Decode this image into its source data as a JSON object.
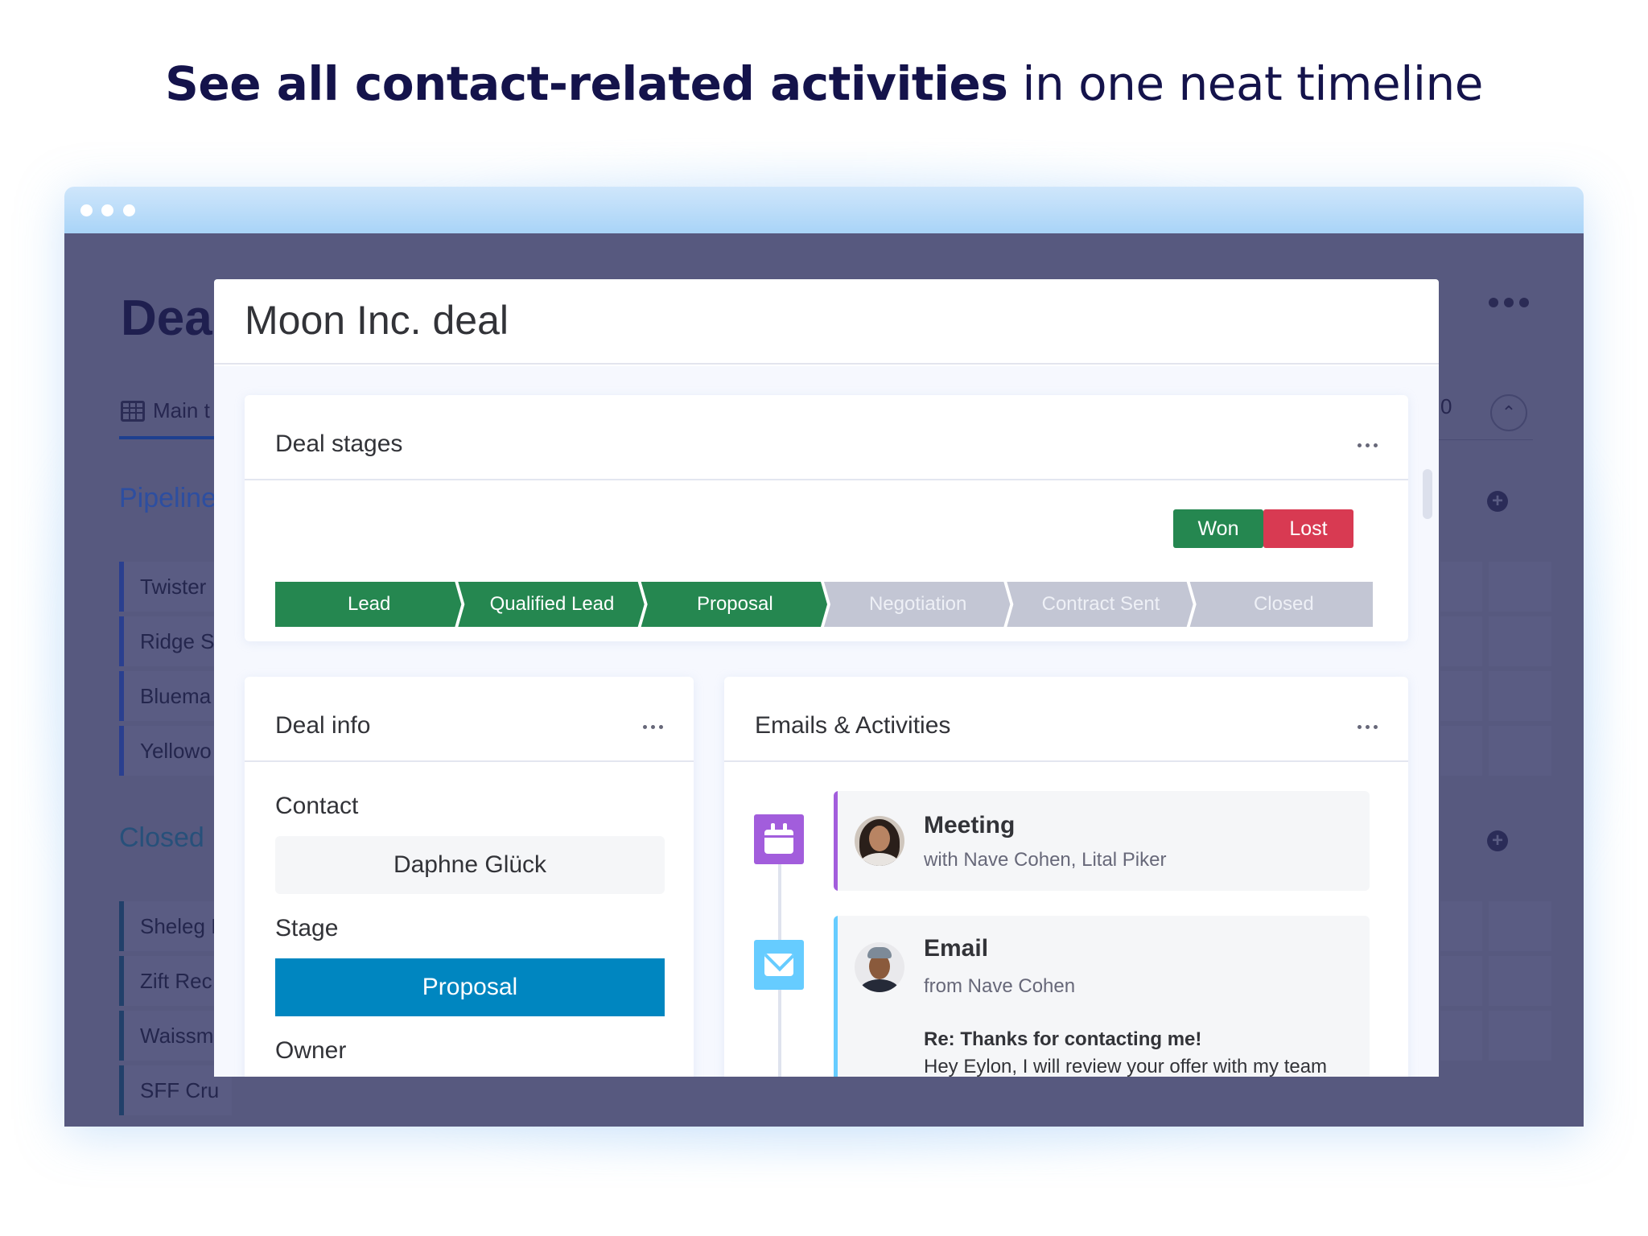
{
  "headline": {
    "bold": "See all contact-related activities",
    "light": "in one neat timeline"
  },
  "background_board": {
    "title": "Deal",
    "tab_label": "Main t",
    "count_partial": "0",
    "groups": [
      {
        "name": "Pipeline",
        "color": "#2d4ea0",
        "rows": [
          "Twister",
          "Ridge S",
          "Bluema",
          "Yellowo"
        ]
      },
      {
        "name": "Closed",
        "color": "#27507a",
        "rows": [
          "Sheleg I",
          "Zift Rec",
          "Waissm",
          "SFF Cru"
        ]
      }
    ]
  },
  "modal": {
    "title": "Moon Inc. deal",
    "deal_stages": {
      "title": "Deal stages",
      "won_label": "Won",
      "lost_label": "Lost",
      "won_color": "#258750",
      "lost_color": "#d83a52",
      "active_color": "#258750",
      "inactive_color": "#c3c6d4",
      "inactive_text_color": "#eef0f6",
      "current_stage_index": 2,
      "stages": [
        "Lead",
        "Qualified Lead",
        "Proposal",
        "Negotiation",
        "Contract Sent",
        "Closed"
      ]
    },
    "deal_info": {
      "title": "Deal info",
      "fields": [
        {
          "label": "Contact",
          "value": "Daphne Glück"
        },
        {
          "label": "Stage",
          "value": "Proposal",
          "color": "#0086c0"
        },
        {
          "label": "Owner",
          "value": ""
        }
      ]
    },
    "activities": {
      "title": "Emails & Activities",
      "items": [
        {
          "type": "meeting",
          "icon": "calendar-icon",
          "color": "#a25ddc",
          "title": "Meeting",
          "subtitle": "with Nave Cohen, Lital Piker"
        },
        {
          "type": "email",
          "icon": "mail-icon",
          "color": "#66ccff",
          "title": "Email",
          "subtitle": "from Nave Cohen",
          "subject": "Re: Thanks for contacting me!",
          "body": "Hey Eylon, I will review your offer with my team"
        }
      ]
    }
  }
}
